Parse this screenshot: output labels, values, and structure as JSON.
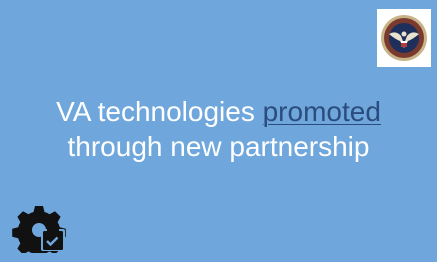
{
  "card": {
    "background": "#6fa7dc"
  },
  "seal": {
    "icon": "va-seal-icon"
  },
  "headline": {
    "before_link": "VA technologies ",
    "link_text": "promoted",
    "line2": "through new partnership",
    "text_color": "#ffffff",
    "link_color": "#2b4c7e"
  },
  "badge": {
    "icon": "gear-checklist-icon"
  }
}
